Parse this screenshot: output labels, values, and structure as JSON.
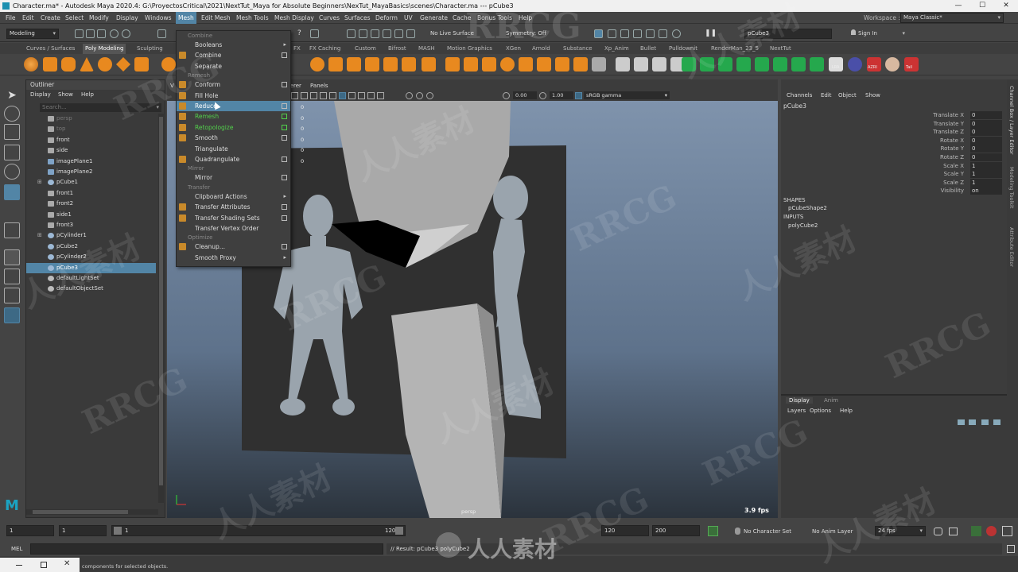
{
  "window": {
    "title": "Character.ma* - Autodesk Maya 2020.4: G:\\ProyectosCritical\\2021\\NextTut_Maya for Absolute Beginners\\NexTut_MayaBasics\\scenes\\Character.ma  ---  pCube3",
    "btn_min": "—",
    "btn_max": "☐",
    "btn_close": "✕"
  },
  "menubar": [
    "File",
    "Edit",
    "Create",
    "Select",
    "Modify",
    "Display",
    "Windows",
    "Mesh",
    "Edit Mesh",
    "Mesh Tools",
    "Mesh Display",
    "Curves",
    "Surfaces",
    "Deform",
    "UV",
    "Generate",
    "Cache",
    "Bonus Tools",
    "Help"
  ],
  "workspace": {
    "label": "Workspace :",
    "value": "Maya Classic*"
  },
  "status_line": {
    "mode": "Modeling",
    "live_surface": "No Live Surface",
    "symmetry": "Symmetry: Off",
    "object_field": "pCube3",
    "sign_in": "Sign In"
  },
  "shelf_tabs": [
    "Curves / Surfaces",
    "Poly Modeling",
    "Sculpting",
    "FX",
    "FX Caching",
    "Custom",
    "Bifrost",
    "MASH",
    "Motion Graphics",
    "XGen",
    "Arnold",
    "Substance",
    "Xp_Anim",
    "Bullet",
    "Pulldownit",
    "RenderMan_23_5",
    "NextTut"
  ],
  "shelf_labels": {
    "lra": "LRA",
    "azri": "AZRI",
    "tail": "Tail"
  },
  "outliner": {
    "title": "Outliner",
    "menus": [
      "Display",
      "Show",
      "Help"
    ],
    "search_placeholder": "Search...",
    "items": [
      {
        "label": "persp",
        "kind": "camera",
        "dim": true
      },
      {
        "label": "top",
        "kind": "camera",
        "dim": true
      },
      {
        "label": "front",
        "kind": "camera"
      },
      {
        "label": "side",
        "kind": "camera"
      },
      {
        "label": "imagePlane1",
        "kind": "plane"
      },
      {
        "label": "imagePlane2",
        "kind": "plane"
      },
      {
        "label": "pCube1",
        "kind": "mesh",
        "expand": true
      },
      {
        "label": "front1",
        "kind": "camera"
      },
      {
        "label": "front2",
        "kind": "camera"
      },
      {
        "label": "side1",
        "kind": "camera"
      },
      {
        "label": "front3",
        "kind": "camera"
      },
      {
        "label": "pCylinder1",
        "kind": "mesh",
        "expand": true
      },
      {
        "label": "pCube2",
        "kind": "mesh"
      },
      {
        "label": "pCylinder2",
        "kind": "mesh"
      },
      {
        "label": "pCube3",
        "kind": "mesh",
        "selected": true
      },
      {
        "label": "defaultLightSet",
        "kind": "set"
      },
      {
        "label": "defaultObjectSet",
        "kind": "set"
      }
    ]
  },
  "mesh_menu": {
    "sections": [
      {
        "title": "Combine",
        "items": [
          {
            "label": "Booleans",
            "submenu": true
          },
          {
            "label": "Combine",
            "option": true
          },
          {
            "label": "Separate"
          }
        ]
      },
      {
        "title": "Remesh",
        "items": [
          {
            "label": "Conform",
            "option": true
          },
          {
            "label": "Fill Hole"
          },
          {
            "label": "Reduce",
            "option": true,
            "highlight": true
          },
          {
            "label": "Remesh",
            "option": true,
            "green": true
          },
          {
            "label": "Retopologize",
            "option": true,
            "green": true
          },
          {
            "label": "Smooth",
            "option": true
          },
          {
            "label": "Triangulate"
          },
          {
            "label": "Quadrangulate",
            "option": true
          }
        ]
      },
      {
        "title": "Mirror",
        "items": [
          {
            "label": "Mirror",
            "option": true
          }
        ]
      },
      {
        "title": "Transfer",
        "items": [
          {
            "label": "Clipboard Actions",
            "submenu": true
          },
          {
            "label": "Transfer Attributes",
            "option": true
          },
          {
            "label": "Transfer Shading Sets",
            "option": true
          },
          {
            "label": "Transfer Vertex Order"
          }
        ]
      },
      {
        "title": "Optimize",
        "items": [
          {
            "label": "Cleanup...",
            "option": true
          },
          {
            "label": "Smooth Proxy",
            "submenu": true
          }
        ]
      }
    ]
  },
  "viewport": {
    "menus": [
      "V",
      "rerer",
      "Panels"
    ],
    "exposure": "0.00",
    "gamma": "1.00",
    "color_space": "sRGB gamma",
    "camera_label": "persp",
    "fps": "3.9 fps",
    "hud_zeros": [
      "0",
      "0",
      "0",
      "0",
      "0",
      "0"
    ]
  },
  "channel_box": {
    "menus": [
      "Channels",
      "Edit",
      "Object",
      "Show"
    ],
    "object": "pCube3",
    "attrs": [
      {
        "label": "Translate X",
        "value": "0"
      },
      {
        "label": "Translate Y",
        "value": "0"
      },
      {
        "label": "Translate Z",
        "value": "0"
      },
      {
        "label": "Rotate X",
        "value": "0"
      },
      {
        "label": "Rotate Y",
        "value": "0"
      },
      {
        "label": "Rotate Z",
        "value": "0"
      },
      {
        "label": "Scale X",
        "value": "1"
      },
      {
        "label": "Scale Y",
        "value": "1"
      },
      {
        "label": "Scale Z",
        "value": "1"
      },
      {
        "label": "Visibility",
        "value": "on"
      }
    ],
    "shapes_header": "SHAPES",
    "shape": "pCubeShape2",
    "inputs_header": "INPUTS",
    "input": "polyCube2"
  },
  "layer_editor": {
    "tabs": [
      "Display",
      "Anim"
    ],
    "menus": [
      "Layers",
      "Options",
      "Help"
    ]
  },
  "side_tabs": [
    "Channel Box / Layer Editor",
    "Modeling Toolkit",
    "Attribute Editor"
  ],
  "time_slider": {
    "start": "1",
    "current": "1",
    "range_start": "1",
    "range_end": "120",
    "end": "120",
    "max_end": "200",
    "character_set": "No Character Set",
    "anim_layer": "No Anim Layer",
    "fps": "24 fps"
  },
  "command_line": {
    "lang": "MEL",
    "result": "// Result: pCube3 polyCube2"
  },
  "help_line": {
    "text": "components for selected objects."
  },
  "watermark": {
    "brand": "RRCG",
    "cn": "人人素材"
  }
}
